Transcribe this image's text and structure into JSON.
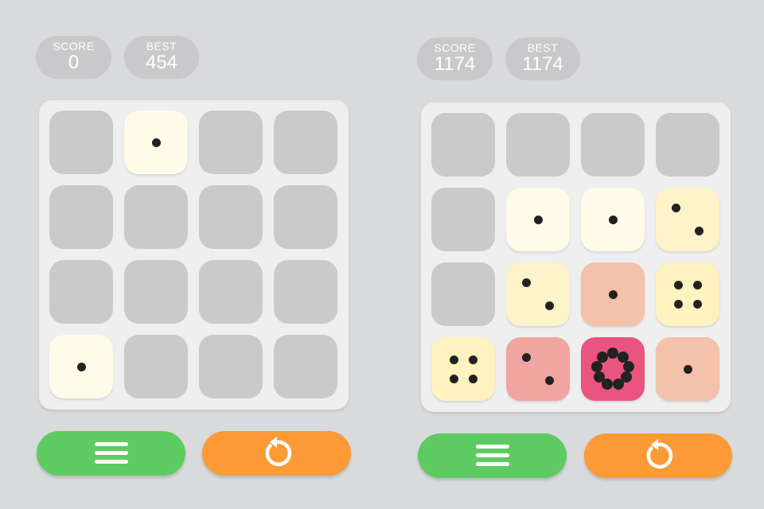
{
  "screens": [
    {
      "score_label": "SCORE",
      "score": "0",
      "best_label": "BEST",
      "best": "454",
      "tiles": [
        {
          "row": 0,
          "col": 1,
          "value": 1,
          "color": "#fefbe9"
        },
        {
          "row": 3,
          "col": 0,
          "value": 1,
          "color": "#fefbe9"
        }
      ],
      "buttons": {
        "menu_icon": "menu-icon",
        "restart_icon": "restart-icon"
      }
    },
    {
      "score_label": "SCORE",
      "score": "1174",
      "best_label": "BEST",
      "best": "1174",
      "tiles": [
        {
          "row": 1,
          "col": 1,
          "value": 1,
          "color": "#fefbe9"
        },
        {
          "row": 1,
          "col": 2,
          "value": 1,
          "color": "#fefbe9"
        },
        {
          "row": 1,
          "col": 3,
          "value": 2,
          "color": "#fdf2c9"
        },
        {
          "row": 2,
          "col": 1,
          "value": 2,
          "color": "#fdf2c9"
        },
        {
          "row": 2,
          "col": 2,
          "value": 1,
          "color": "#f4c1aa"
        },
        {
          "row": 2,
          "col": 3,
          "value": 4,
          "color": "#fdf2c0"
        },
        {
          "row": 3,
          "col": 0,
          "value": 4,
          "color": "#fdf2c0"
        },
        {
          "row": 3,
          "col": 1,
          "value": 2,
          "color": "#f1a5a0"
        },
        {
          "row": 3,
          "col": 2,
          "value": 9,
          "color": "#e95580"
        },
        {
          "row": 3,
          "col": 3,
          "value": 1,
          "color": "#f4c1aa"
        }
      ],
      "buttons": {
        "menu_icon": "menu-icon",
        "restart_icon": "restart-icon"
      }
    }
  ]
}
